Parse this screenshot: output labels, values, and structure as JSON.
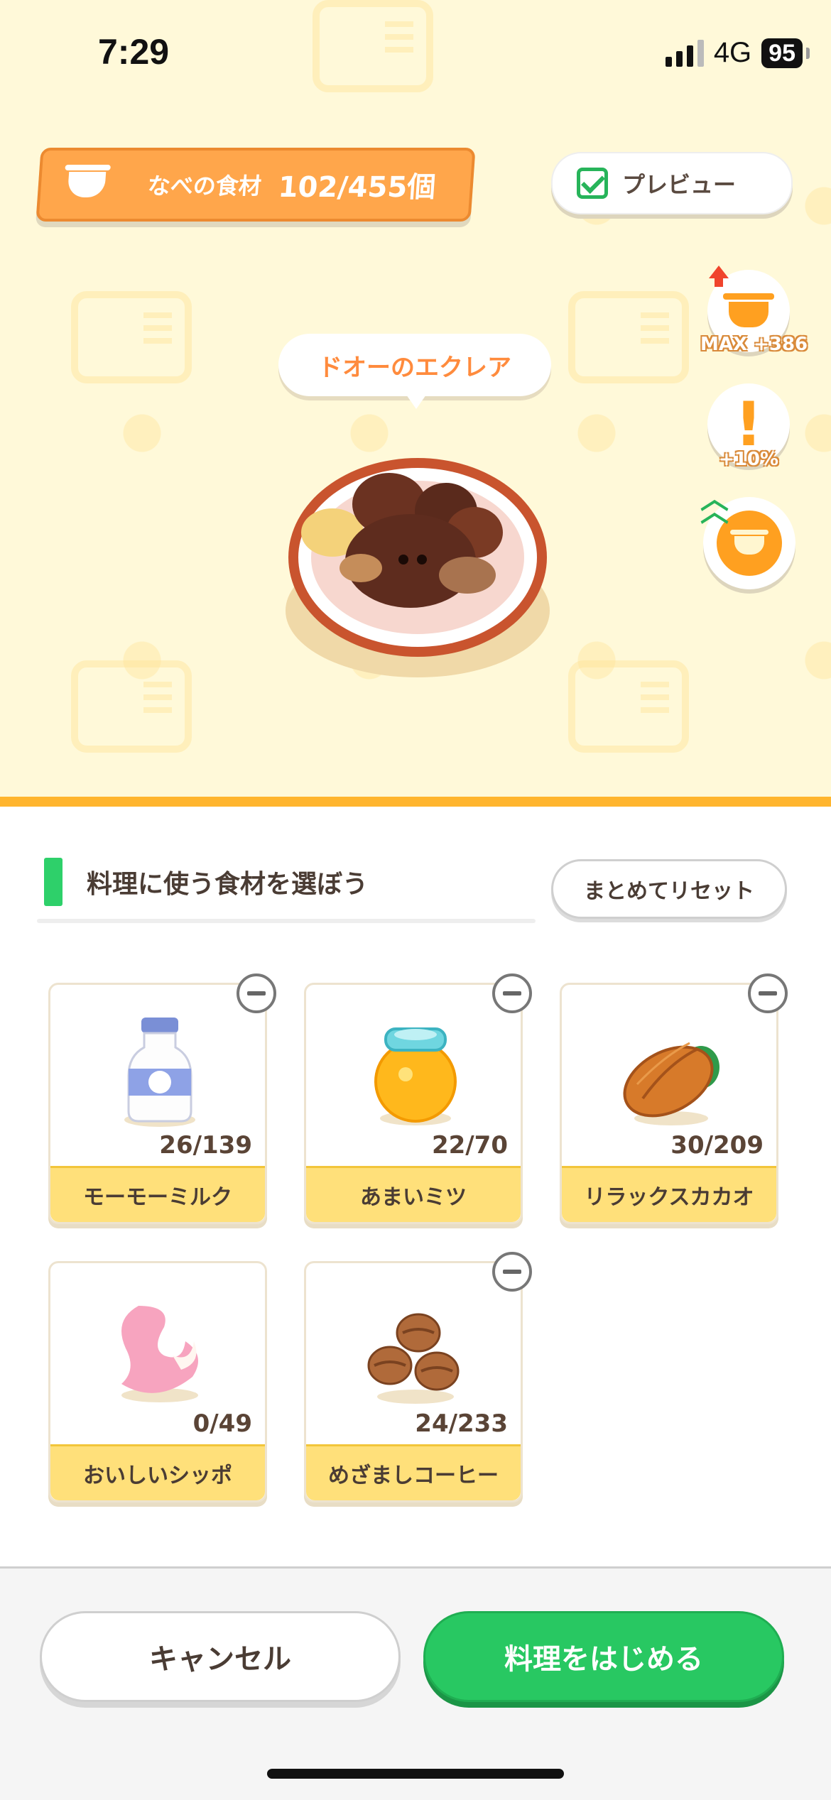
{
  "status_bar": {
    "time": "7:29",
    "network": "4G",
    "battery": "95"
  },
  "pot": {
    "label": "なべの食材",
    "count": "102/455個"
  },
  "preview": {
    "label": "プレビュー",
    "checked": true
  },
  "side_buttons": {
    "pot_capacity_label": "MAX +386",
    "bonus_label": "+10%"
  },
  "dish": {
    "name": "ドオーのエクレア"
  },
  "section": {
    "title": "料理に使う食材を選ぼう",
    "reset_label": "まとめてリセット"
  },
  "ingredients": [
    {
      "name": "モーモーミルク",
      "qty": "26/139",
      "icon": "milk-bottle-icon",
      "removable": true
    },
    {
      "name": "あまいミツ",
      "qty": "22/70",
      "icon": "honey-jar-icon",
      "removable": true
    },
    {
      "name": "リラックスカカオ",
      "qty": "30/209",
      "icon": "cacao-pod-icon",
      "removable": true
    },
    {
      "name": "おいしいシッポ",
      "qty": "0/49",
      "icon": "slowpoke-tail-icon",
      "removable": false
    },
    {
      "name": "めざましコーヒー",
      "qty": "24/233",
      "icon": "coffee-beans-icon",
      "removable": true
    }
  ],
  "footer": {
    "cancel_label": "キャンセル",
    "start_label": "料理をはじめる"
  },
  "colors": {
    "accent_orange": "#ffa64b",
    "green": "#28c862",
    "card_label_bg": "#ffe07a"
  }
}
